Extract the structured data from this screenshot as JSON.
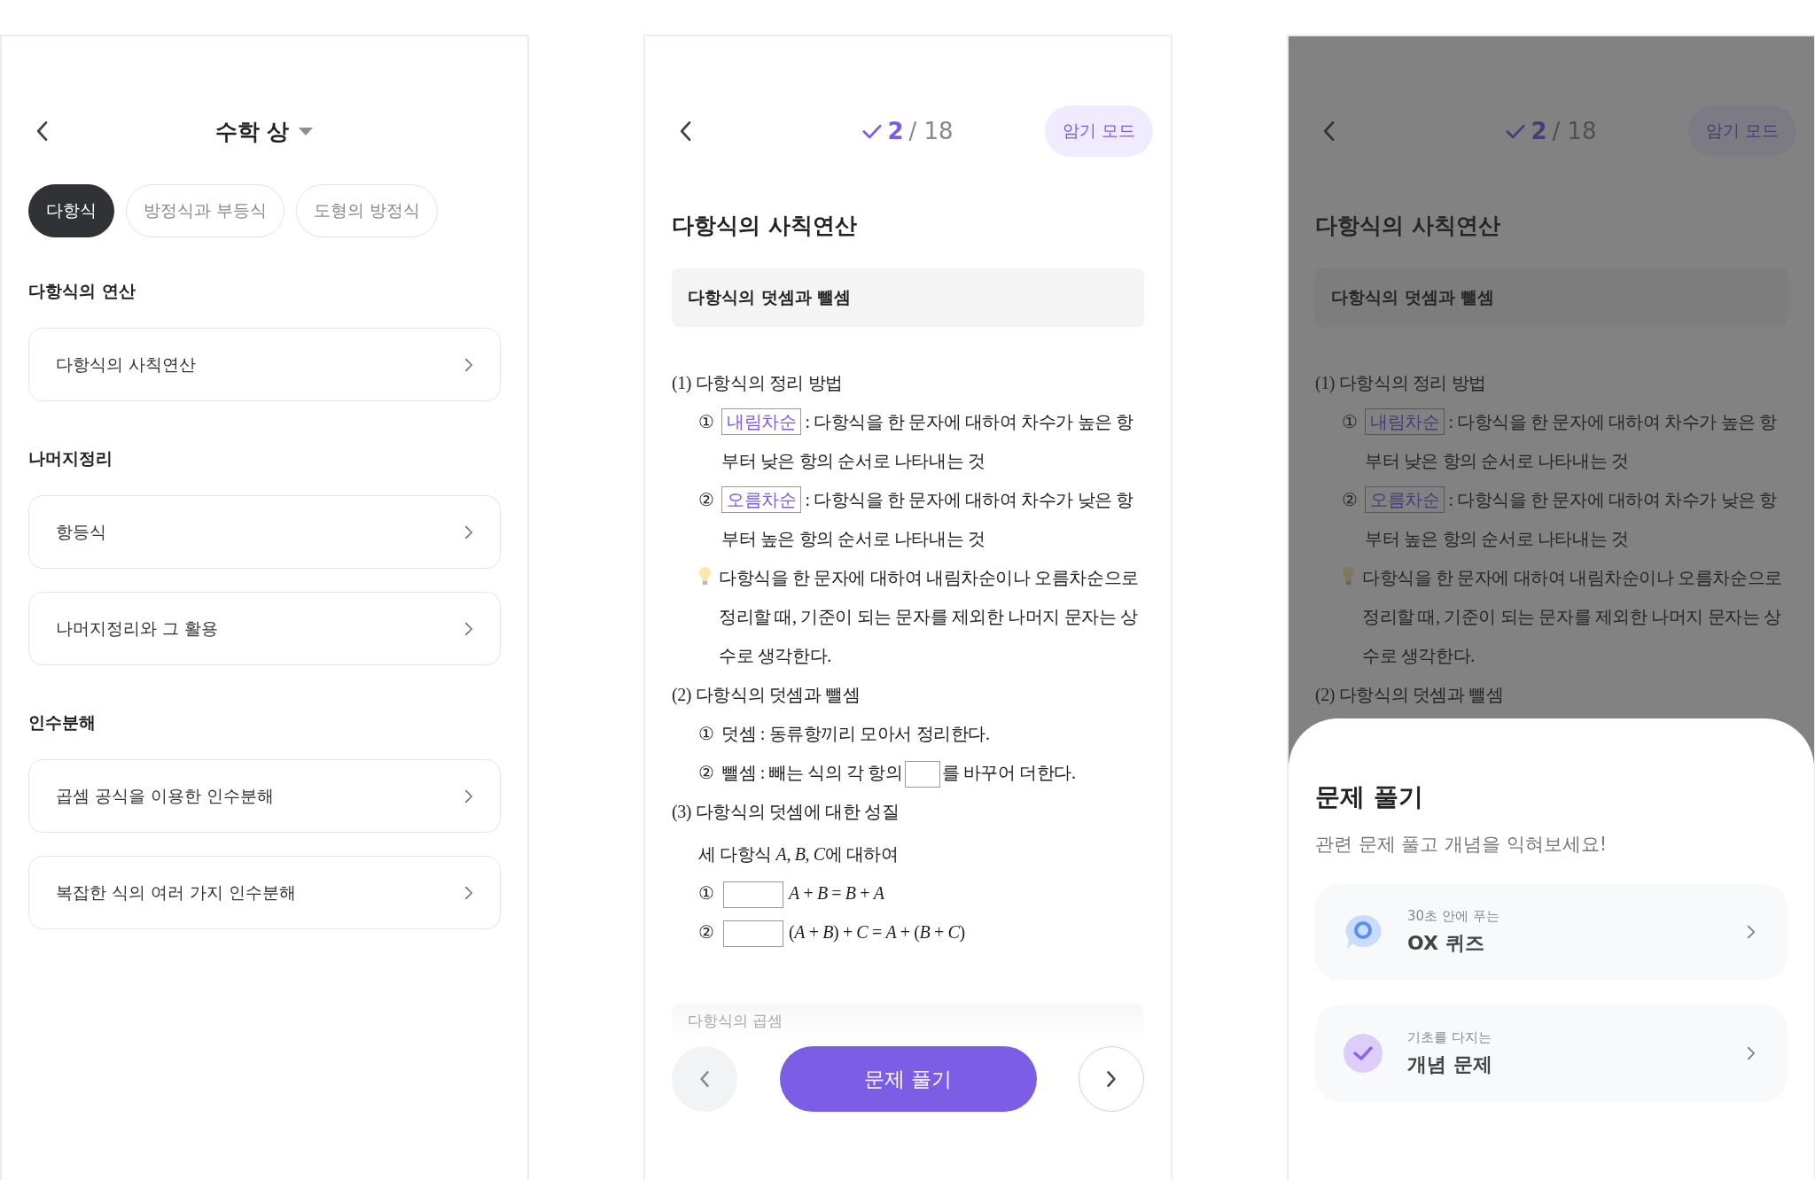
{
  "screens": [
    {
      "kind": "chapter_list",
      "title": "수학 상",
      "tabs": [
        {
          "label": "다항식",
          "selected": true
        },
        {
          "label": "방정식과 부등식",
          "selected": false
        },
        {
          "label": "도형의 방정식",
          "selected": false
        }
      ],
      "sections": [
        {
          "heading": "다항식의 연산",
          "items": [
            {
              "label": "다항식의 사칙연산"
            }
          ]
        },
        {
          "heading": "나머지정리",
          "items": [
            {
              "label": "항등식"
            },
            {
              "label": "나머지정리와 그 활용"
            }
          ]
        },
        {
          "heading": "인수분해",
          "items": [
            {
              "label": "곱셈 공식을 이용한 인수분해"
            },
            {
              "label": "복잡한 식의 여러 가지 인수분해"
            }
          ]
        }
      ]
    },
    {
      "kind": "concept",
      "progress": {
        "current": "2",
        "total": "/ 18"
      },
      "mode_button": "암기 모드",
      "title": "다항식의 사칙연산",
      "subtitle": "다항식의 덧셈과 뺄셈",
      "doc": [
        {
          "kind": "heading",
          "text": "(1) 다항식의 정리 방법"
        },
        {
          "kind": "item",
          "marker": "①",
          "parts": [
            {
              "kind": "blank",
              "text": "내림차순"
            },
            {
              "kind": "text",
              "text": ": 다항식을 한 문자에 대하여 차수가 높은 항부터 낮은 항의 순서로 나타내는 것"
            }
          ]
        },
        {
          "kind": "item",
          "marker": "②",
          "parts": [
            {
              "kind": "blank",
              "text": "오름차순"
            },
            {
              "kind": "text",
              "text": ": 다항식을 한 문자에 대하여 차수가 낮은 항부터 높은 항의 순서로 나타내는 것"
            }
          ]
        },
        {
          "kind": "tip",
          "text": "다항식을 한 문자에 대하여 내림차순이나 오름차순으로 정리할 때, 기준이 되는 문자를 제외한 나머지 문자는 상수로 생각한다."
        },
        {
          "kind": "heading",
          "text": "(2) 다항식의 덧셈과 뺄셈"
        },
        {
          "kind": "item",
          "marker": "①",
          "parts": [
            {
              "kind": "text",
              "text": "덧셈 : 동류항끼리 모아서 정리한다."
            }
          ]
        },
        {
          "kind": "item",
          "marker": "②",
          "parts": [
            {
              "kind": "text",
              "text": "뺄셈 : 빼는 식의 각 항의"
            },
            {
              "kind": "gap",
              "wide": false
            },
            {
              "kind": "text",
              "text": "를 바꾸어 더한다."
            }
          ]
        },
        {
          "kind": "heading",
          "text": "(3) 다항식의 덧셈에 대한 성질"
        },
        {
          "kind": "para",
          "parts": [
            "세 다항식 *A*, *B*, *C*",
            "에 대하여"
          ]
        },
        {
          "kind": "item",
          "marker": "①",
          "parts": [
            {
              "kind": "gap",
              "wide": true
            },
            {
              "kind": "text",
              "text": "*A* + *B* = *B* + *A*"
            }
          ]
        },
        {
          "kind": "item",
          "marker": "②",
          "parts": [
            {
              "kind": "gap",
              "wide": true
            },
            {
              "kind": "text",
              "text": "(*A* + *B*) + *C* = *A* + (*B* + *C*)"
            }
          ]
        }
      ],
      "next_card": "다항식의 곱셈",
      "solve_button": "문제 풀기"
    },
    {
      "kind": "concept",
      "progress": {
        "current": "2",
        "total": "/ 18"
      },
      "mode_button": "암기 모드",
      "title": "다항식의 사칙연산",
      "subtitle": "다항식의 덧셈과 뺄셈",
      "doc": [
        {
          "kind": "heading",
          "text": "(1) 다항식의 정리 방법"
        },
        {
          "kind": "item",
          "marker": "①",
          "parts": [
            {
              "kind": "blank",
              "text": "내림차순"
            },
            {
              "kind": "text",
              "text": ": 다항식을 한 문자에 대하여 차수가 높은 항부터 낮은 항의 순서로 나타내는 것"
            }
          ]
        },
        {
          "kind": "item",
          "marker": "②",
          "parts": [
            {
              "kind": "blank",
              "text": "오름차순"
            },
            {
              "kind": "text",
              "text": ": 다항식을 한 문자에 대하여 차수가 낮은 항부터 높은 항의 순서로 나타내는 것"
            }
          ]
        },
        {
          "kind": "tip",
          "text": "다항식을 한 문자에 대하여 내림차순이나 오름차순으로 정리할 때, 기준이 되는 문자를 제외한 나머지 문자는 상수로 생각한다."
        },
        {
          "kind": "heading",
          "text": "(2) 다항식의 덧셈과 뺄셈"
        }
      ],
      "sheet": {
        "title": "문제 풀기",
        "subtitle": "관련 문제 풀고 개념을 익혀보세요!",
        "options": [
          {
            "kind": "ox",
            "caption": "30초 안에 푸는",
            "label": "OX 퀴즈"
          },
          {
            "kind": "concept",
            "caption": "기초를 다지는",
            "label": "개념 문제"
          }
        ]
      }
    }
  ]
}
